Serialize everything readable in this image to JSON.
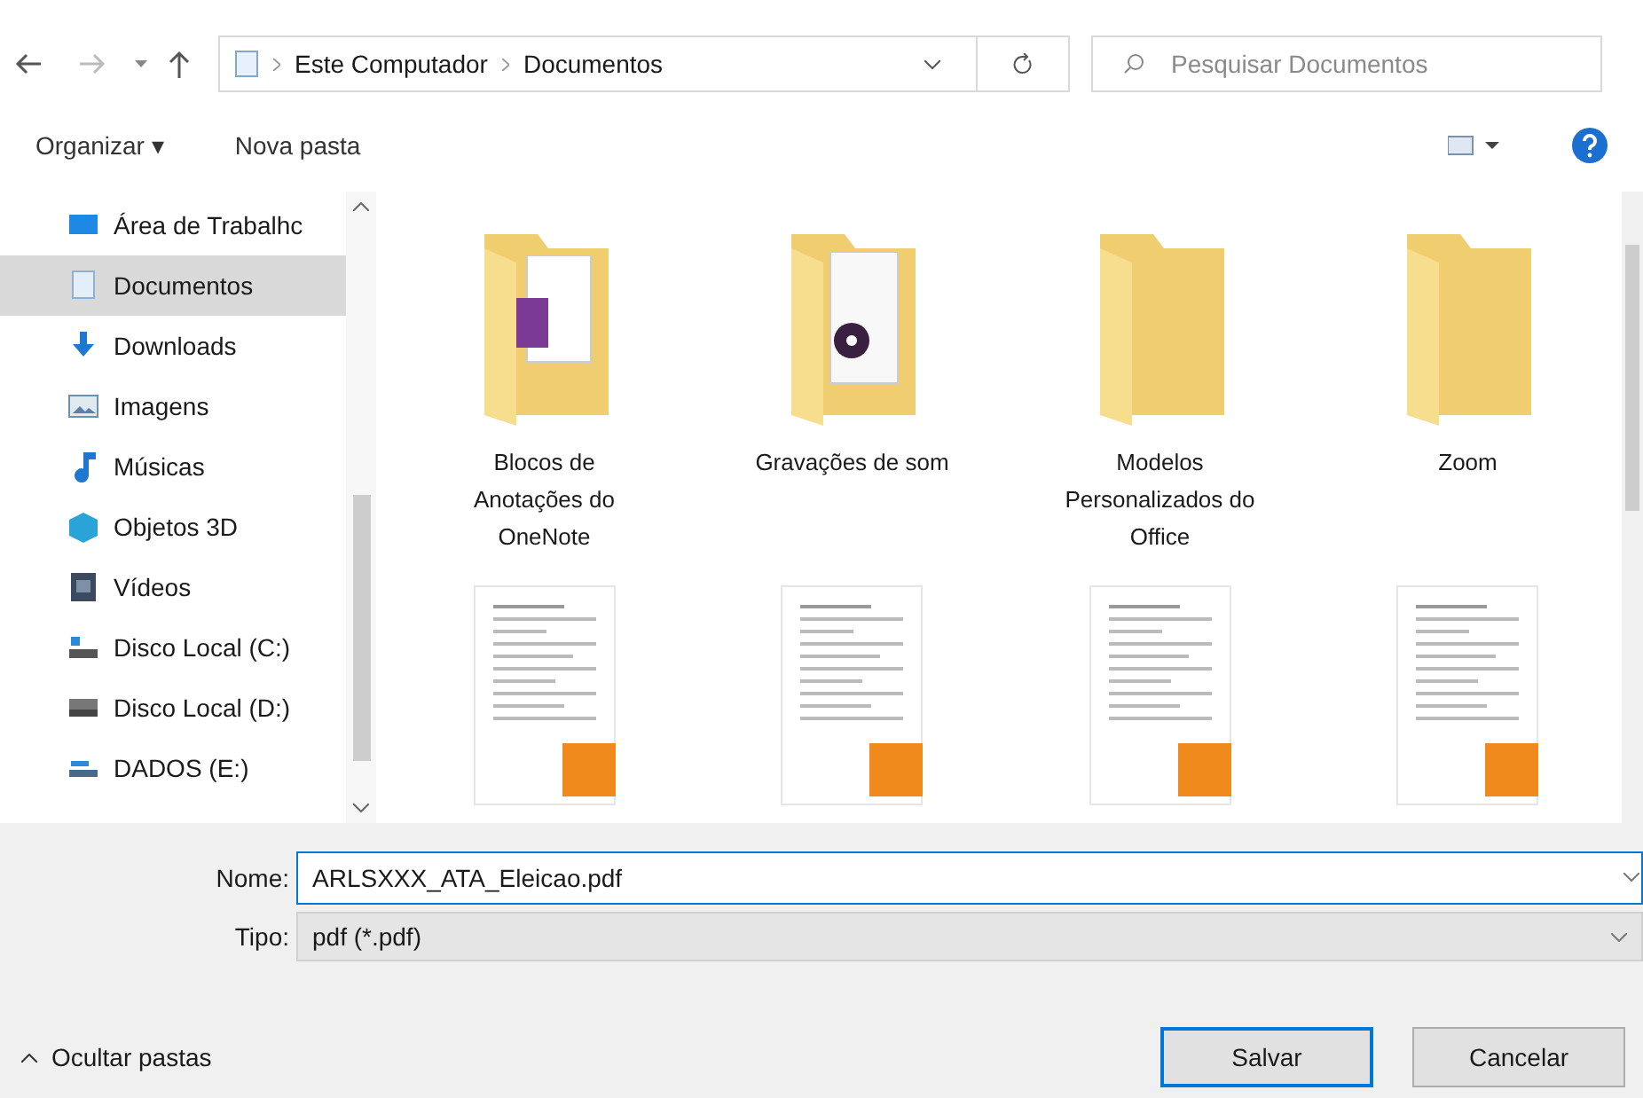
{
  "nav": {
    "breadcrumb": [
      "Este Computador",
      "Documentos"
    ],
    "search": {
      "placeholder": "Pesquisar Documentos"
    }
  },
  "toolbar": {
    "organize": "Organizar ▾",
    "new_folder": "Nova pasta"
  },
  "sidebar": {
    "items": [
      {
        "label": "Área de Trabalhc",
        "kind": "desktop",
        "selected": false
      },
      {
        "label": "Documentos",
        "kind": "documents",
        "selected": true
      },
      {
        "label": "Downloads",
        "kind": "downloads",
        "selected": false
      },
      {
        "label": "Imagens",
        "kind": "pictures",
        "selected": false
      },
      {
        "label": "Músicas",
        "kind": "music",
        "selected": false
      },
      {
        "label": "Objetos 3D",
        "kind": "objects3d",
        "selected": false
      },
      {
        "label": "Vídeos",
        "kind": "videos",
        "selected": false
      },
      {
        "label": "Disco Local (C:)",
        "kind": "system-drive",
        "selected": false
      },
      {
        "label": "Disco Local (D:)",
        "kind": "drive",
        "selected": false
      },
      {
        "label": "DADOS (E:)",
        "kind": "network-drive",
        "selected": false
      }
    ]
  },
  "files": [
    {
      "kind": "folder-onenote",
      "name": "Blocos de Anotações do OneNote"
    },
    {
      "kind": "folder-media",
      "name": "Gravações de som"
    },
    {
      "kind": "folder",
      "name": "Modelos Personalizados do Office"
    },
    {
      "kind": "folder",
      "name": "Zoom"
    },
    {
      "kind": "pdf"
    },
    {
      "kind": "pdf"
    },
    {
      "kind": "pdf"
    },
    {
      "kind": "pdf"
    }
  ],
  "form": {
    "name_label": "Nome:",
    "name_value": "ARLSXXX_ATA_Eleicao.pdf",
    "type_label": "Tipo:",
    "type_value": "pdf (*.pdf)"
  },
  "footer": {
    "hide_folders": "Ocultar pastas",
    "buttons": [
      {
        "label": "Salvar",
        "kind": "primary"
      },
      {
        "label": "Cancelar",
        "kind": "secondary"
      }
    ]
  }
}
